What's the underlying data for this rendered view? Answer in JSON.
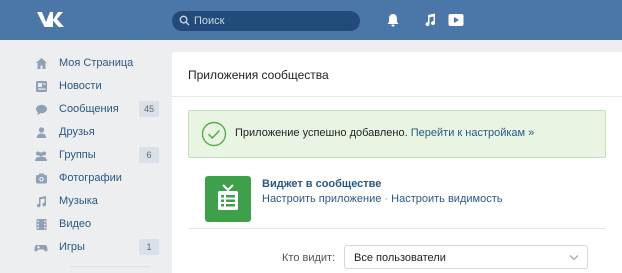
{
  "header": {
    "logo_text": "VK",
    "search_placeholder": "Поиск",
    "icons": [
      "bell-icon",
      "music-note-icon",
      "play-icon"
    ],
    "colors": {
      "bar": "#4a76a8",
      "search": "#224b7a"
    }
  },
  "sidebar": {
    "items": [
      {
        "label": "Моя Страница",
        "icon": "home-icon"
      },
      {
        "label": "Новости",
        "icon": "news-icon"
      },
      {
        "label": "Сообщения",
        "icon": "messages-icon",
        "badge": "45"
      },
      {
        "label": "Друзья",
        "icon": "friends-icon"
      },
      {
        "label": "Группы",
        "icon": "groups-icon",
        "badge": "6"
      },
      {
        "label": "Фотографии",
        "icon": "camera-icon"
      },
      {
        "label": "Музыка",
        "icon": "music-icon"
      },
      {
        "label": "Видео",
        "icon": "video-icon"
      },
      {
        "label": "Игры",
        "icon": "games-icon",
        "badge": "1"
      }
    ]
  },
  "main": {
    "title": "Приложения сообщества",
    "notice": {
      "text": "Приложение успешно добавлено.",
      "link": "Перейти к настройкам »"
    },
    "app": {
      "name": "Виджет в сообществе",
      "configure_link": "Настроить приложение",
      "separator": " · ",
      "visibility_link": "Настроить видимость",
      "icon_color": "#3ea04b"
    },
    "visibility": {
      "label": "Кто видит:",
      "value": "Все пользователи"
    }
  }
}
